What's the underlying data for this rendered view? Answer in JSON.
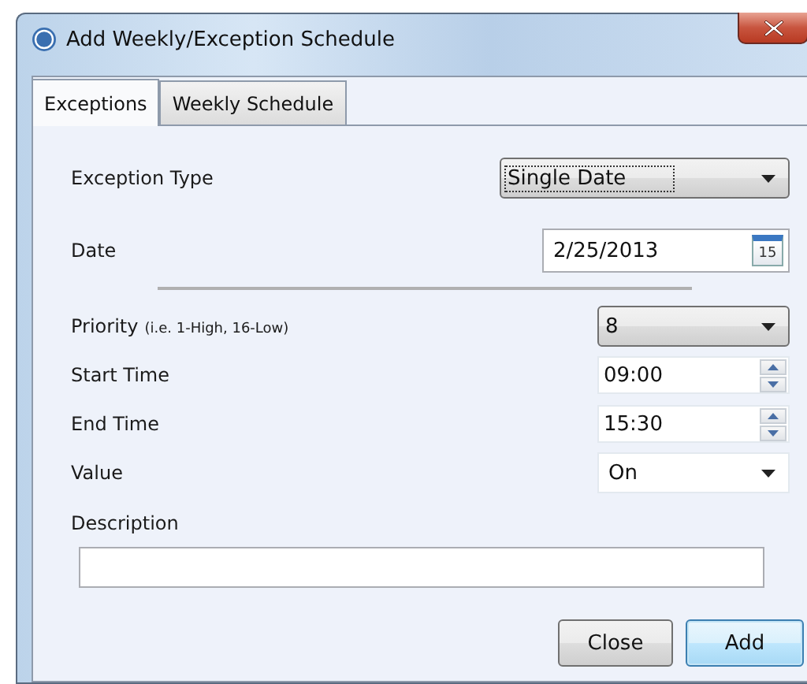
{
  "window": {
    "title": "Add Weekly/Exception Schedule"
  },
  "tabs": [
    {
      "label": "Exceptions",
      "selected": true
    },
    {
      "label": "Weekly Schedule",
      "selected": false
    }
  ],
  "fields": [
    {
      "kind": "combo",
      "label": "Exception Type",
      "value": "Single Date",
      "focused": true
    },
    {
      "kind": "date",
      "label": "Date",
      "value": "2/25/2013",
      "calendar_day": "15"
    },
    {
      "kind": "divider"
    },
    {
      "kind": "combo",
      "label": "Priority",
      "hint": "(i.e. 1-High, 16-Low)",
      "value": "8",
      "focused": false
    },
    {
      "kind": "spinner",
      "label": "Start Time",
      "value": "09:00"
    },
    {
      "kind": "spinner",
      "label": "End Time",
      "value": "15:30"
    },
    {
      "kind": "select",
      "label": "Value",
      "value": "On"
    }
  ],
  "description": {
    "label": "Description"
  },
  "buttons": [
    {
      "label": "Close",
      "default": false
    },
    {
      "label": "Add",
      "default": true
    }
  ]
}
